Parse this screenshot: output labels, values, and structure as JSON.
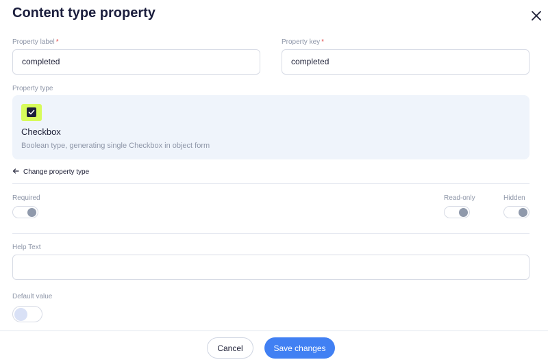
{
  "dialog": {
    "title": "Content type property"
  },
  "property_label": {
    "label": "Property label",
    "required_mark": "*",
    "value": "completed"
  },
  "property_key": {
    "label": "Property key",
    "required_mark": "*",
    "value": "completed"
  },
  "property_type": {
    "label": "Property type",
    "name": "Checkbox",
    "description": "Boolean type, generating single Checkbox in object form",
    "icon": "checkbox-icon",
    "icon_bg": "#d7fb5b"
  },
  "change_type": {
    "label": "Change property type",
    "icon": "arrow-left-icon"
  },
  "toggles": {
    "required": {
      "label": "Required",
      "on": true
    },
    "read_only": {
      "label": "Read-only",
      "on": true
    },
    "hidden": {
      "label": "Hidden",
      "on": true
    }
  },
  "help_text": {
    "label": "Help Text",
    "value": ""
  },
  "default_value": {
    "label": "Default value",
    "on": false
  },
  "footer": {
    "cancel_label": "Cancel",
    "save_label": "Save changes",
    "accent": "#4180f3"
  }
}
